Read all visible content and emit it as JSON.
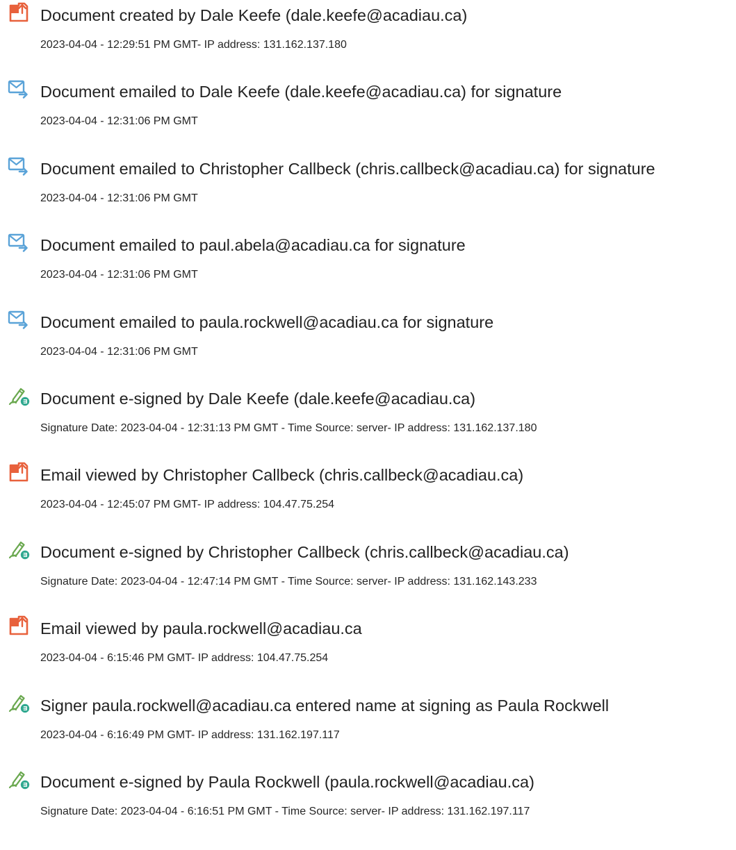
{
  "events": [
    {
      "icon": "document-created-icon",
      "title": "Document created by Dale Keefe (dale.keefe@acadiau.ca)",
      "detail": "2023-04-04 - 12:29:51 PM GMT- IP address: 131.162.137.180"
    },
    {
      "icon": "email-sent-icon",
      "title": "Document emailed to Dale Keefe (dale.keefe@acadiau.ca) for signature",
      "detail": "2023-04-04 - 12:31:06 PM GMT"
    },
    {
      "icon": "email-sent-icon",
      "title": "Document emailed to Christopher Callbeck (chris.callbeck@acadiau.ca) for signature",
      "detail": "2023-04-04 - 12:31:06 PM GMT"
    },
    {
      "icon": "email-sent-icon",
      "title": "Document emailed to paul.abela@acadiau.ca for signature",
      "detail": "2023-04-04 - 12:31:06 PM GMT"
    },
    {
      "icon": "email-sent-icon",
      "title": "Document emailed to paula.rockwell@acadiau.ca for signature",
      "detail": "2023-04-04 - 12:31:06 PM GMT"
    },
    {
      "icon": "e-sign-pen-icon",
      "title": "Document e-signed by Dale Keefe (dale.keefe@acadiau.ca)",
      "detail": "Signature Date: 2023-04-04 - 12:31:13 PM GMT - Time Source: server- IP address: 131.162.137.180"
    },
    {
      "icon": "document-viewed-icon",
      "title": "Email viewed by Christopher Callbeck (chris.callbeck@acadiau.ca)",
      "detail": "2023-04-04 - 12:45:07 PM GMT- IP address: 104.47.75.254"
    },
    {
      "icon": "e-sign-pen-icon",
      "title": "Document e-signed by Christopher Callbeck (chris.callbeck@acadiau.ca)",
      "detail": "Signature Date: 2023-04-04 - 12:47:14 PM GMT - Time Source: server- IP address: 131.162.143.233"
    },
    {
      "icon": "document-viewed-icon",
      "title": "Email viewed by paula.rockwell@acadiau.ca",
      "detail": "2023-04-04 - 6:15:46 PM GMT- IP address: 104.47.75.254"
    },
    {
      "icon": "e-sign-pen-icon",
      "title": "Signer paula.rockwell@acadiau.ca entered name at signing as Paula Rockwell",
      "detail": "2023-04-04 - 6:16:49 PM GMT- IP address: 131.162.197.117"
    },
    {
      "icon": "e-sign-pen-icon",
      "title": "Document e-signed by Paula Rockwell (paula.rockwell@acadiau.ca)",
      "detail": "Signature Date: 2023-04-04 - 6:16:51 PM GMT - Time Source: server- IP address: 131.162.197.117"
    }
  ],
  "colors": {
    "document_icon": "#e8613c",
    "email_icon": "#5aa3d8",
    "pen_icon": "#6aa84f",
    "badge": "#2fa88f"
  }
}
